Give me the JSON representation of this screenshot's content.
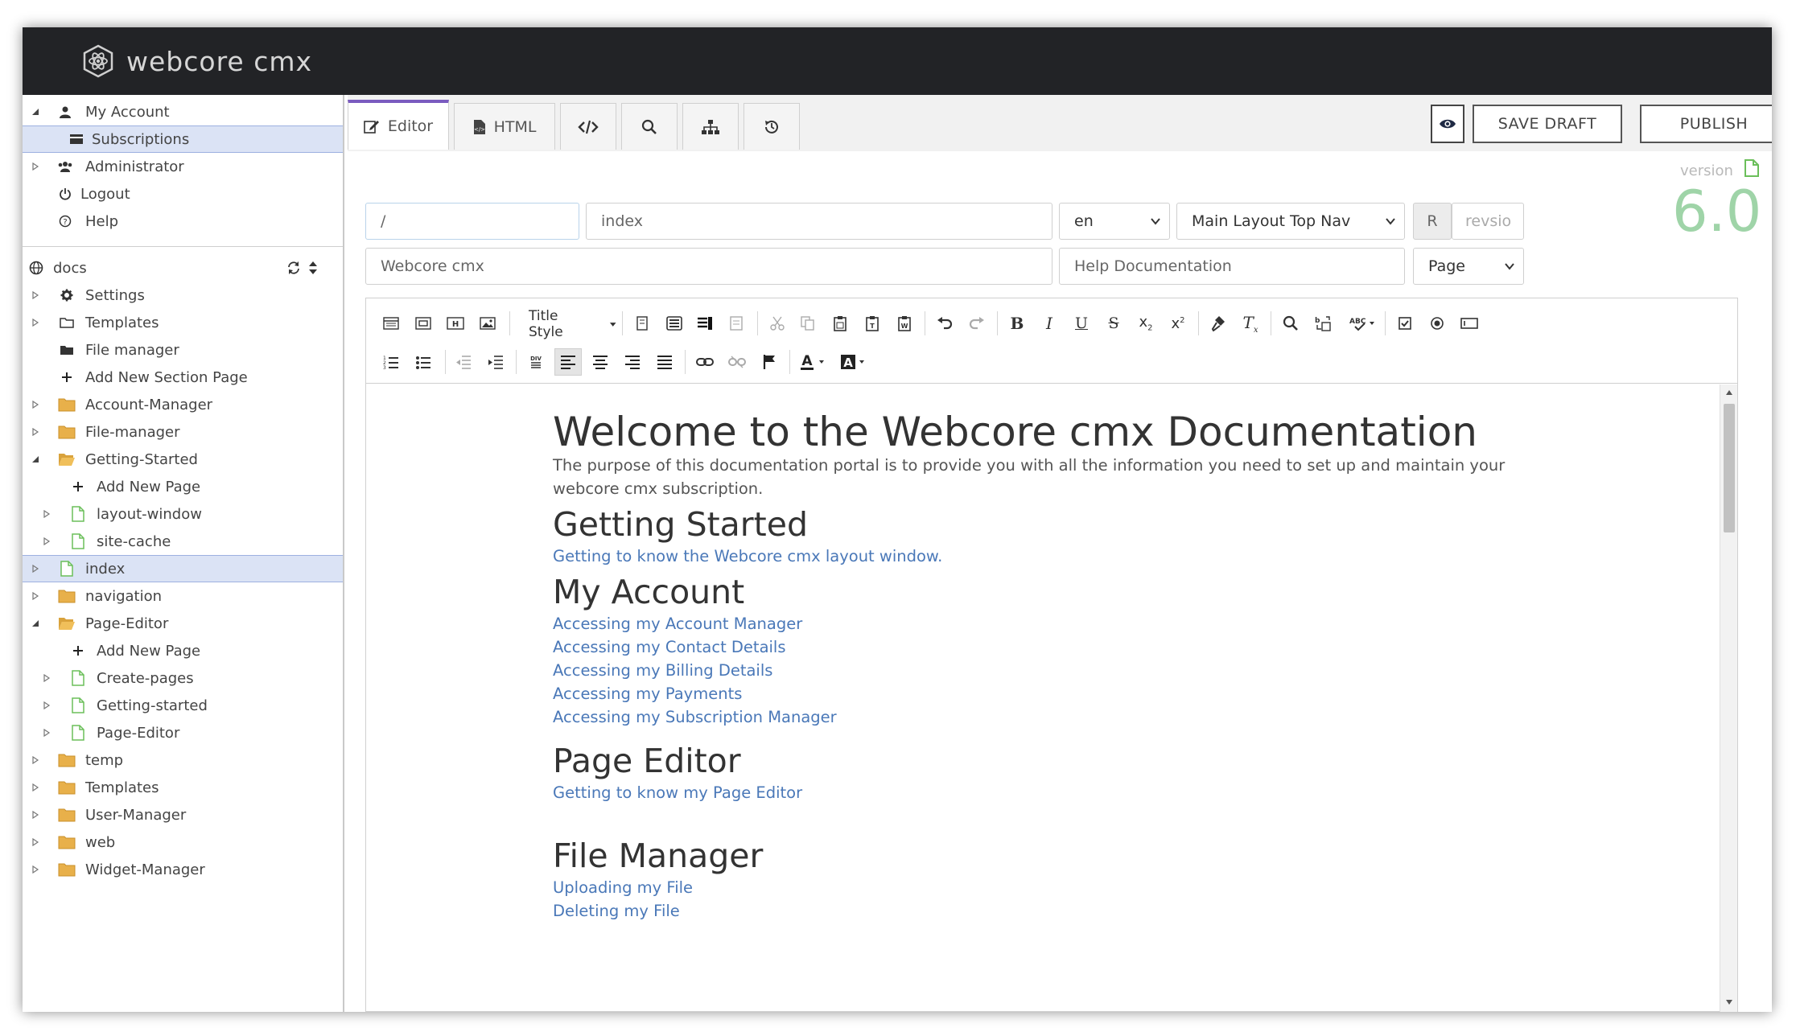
{
  "app": {
    "logo_text": "webcore cmx"
  },
  "sidebar": {
    "account_items": [
      {
        "label": "My Account",
        "icon": "user-icon"
      },
      {
        "label": "Subscriptions",
        "icon": "card-icon"
      },
      {
        "label": "Administrator",
        "icon": "users-icon"
      },
      {
        "label": "Logout",
        "icon": "power-icon"
      },
      {
        "label": "Help",
        "icon": "help-icon"
      }
    ],
    "site": {
      "label": "docs",
      "icon": "globe-icon"
    },
    "tree": [
      {
        "label": "Settings"
      },
      {
        "label": "Templates"
      },
      {
        "label": "File manager"
      },
      {
        "label": "Add New Section Page"
      },
      {
        "label": "Account-Manager"
      },
      {
        "label": "File-manager"
      },
      {
        "label": "Getting-Started"
      },
      {
        "label": "Add New Page"
      },
      {
        "label": "layout-window"
      },
      {
        "label": "site-cache"
      },
      {
        "label": "index"
      },
      {
        "label": "navigation"
      },
      {
        "label": "Page-Editor"
      },
      {
        "label": "Add New Page"
      },
      {
        "label": "Create-pages"
      },
      {
        "label": "Getting-started"
      },
      {
        "label": "Page-Editor"
      },
      {
        "label": "temp"
      },
      {
        "label": "Templates"
      },
      {
        "label": "User-Manager"
      },
      {
        "label": "web"
      },
      {
        "label": "Widget-Manager"
      }
    ]
  },
  "tabs": {
    "editor": "Editor",
    "html": "HTML"
  },
  "buttons": {
    "save_draft": "SAVE DRAFT",
    "publish": "PUBLISH"
  },
  "fields": {
    "path": "/",
    "page_name": "index",
    "language": "en",
    "layout": "Main Layout Top Nav",
    "r_label": "R",
    "revision_placeholder": "revsio",
    "site_title": "Webcore cmx",
    "page_title": "Help Documentation",
    "page_type": "Page"
  },
  "version": {
    "label": "version",
    "number": "6.0"
  },
  "toolbar": {
    "title_style": "Title Style"
  },
  "document": {
    "heading": "Welcome to the Webcore cmx Documentation",
    "intro": "The  purpose of this documentation portal is to provide you with all the information you need to set up and maintain your webcore cmx subscription.",
    "sections": [
      {
        "title": "Getting Started",
        "links": [
          "Getting to know the Webcore cmx layout window."
        ]
      },
      {
        "title": "My Account",
        "links": [
          "Accessing my Account Manager",
          "Accessing my Contact Details",
          "Accessing my Billing Details",
          "Accessing my Payments",
          "Accessing my Subscription Manager"
        ]
      },
      {
        "title": "Page Editor",
        "links": [
          "Getting to know my Page Editor"
        ]
      },
      {
        "title": "File Manager",
        "links": [
          "Uploading my File",
          "Deleting my File"
        ]
      }
    ]
  },
  "colors": {
    "header_bg": "#222326",
    "accent": "#7a5bbf",
    "link": "#4a78b8",
    "folder": "#e8b04a",
    "version": "#9fd4a8"
  }
}
